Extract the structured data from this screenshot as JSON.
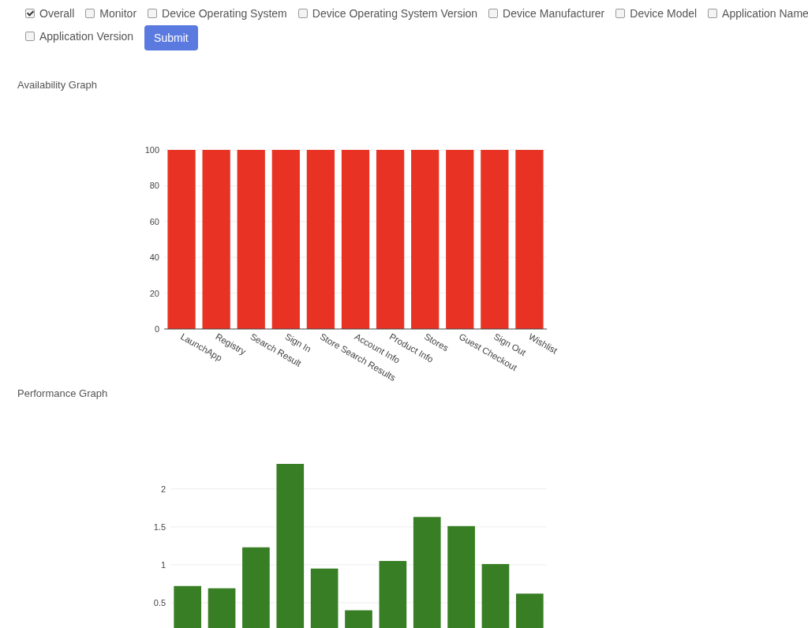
{
  "filters": [
    {
      "label": "Overall",
      "checked": true
    },
    {
      "label": "Monitor",
      "checked": false
    },
    {
      "label": "Device Operating System",
      "checked": false
    },
    {
      "label": "Device Operating System Version",
      "checked": false
    },
    {
      "label": "Device Manufacturer",
      "checked": false
    },
    {
      "label": "Device Model",
      "checked": false
    },
    {
      "label": "Application Name",
      "checked": false
    },
    {
      "label": "Application Version",
      "checked": false
    }
  ],
  "submit_button": "Submit",
  "graphs": [
    {
      "title": "Availability Graph",
      "chart_data": {
        "type": "bar",
        "categories": [
          "LaunchApp",
          "Registry",
          "Search Result",
          "Sign In",
          "Store Search Results",
          "Account Info",
          "Product Info",
          "Stores",
          "Guest Checkout",
          "Sign Out",
          "Wishlist"
        ],
        "series": [
          {
            "color": "#e83324",
            "values": [
              100,
              100,
              100,
              100,
              100,
              100,
              100,
              100,
              100,
              100,
              100
            ]
          }
        ],
        "ylim": [
          0,
          100
        ],
        "yticks": [
          0,
          20,
          40,
          60,
          80,
          100
        ],
        "grid": true
      }
    },
    {
      "title": "Performance Graph",
      "chart_data": {
        "type": "bar",
        "series": [
          {
            "color": "#387e24",
            "values": [
              0.72,
              0.69,
              1.23,
              2.33,
              0.95,
              0.4,
              1.05,
              1.63,
              1.51,
              1.01,
              0.62
            ]
          }
        ],
        "ylim": [
          0,
          2.33
        ],
        "yticks": [
          0.5,
          1,
          1.5,
          2
        ],
        "grid": true
      }
    }
  ]
}
